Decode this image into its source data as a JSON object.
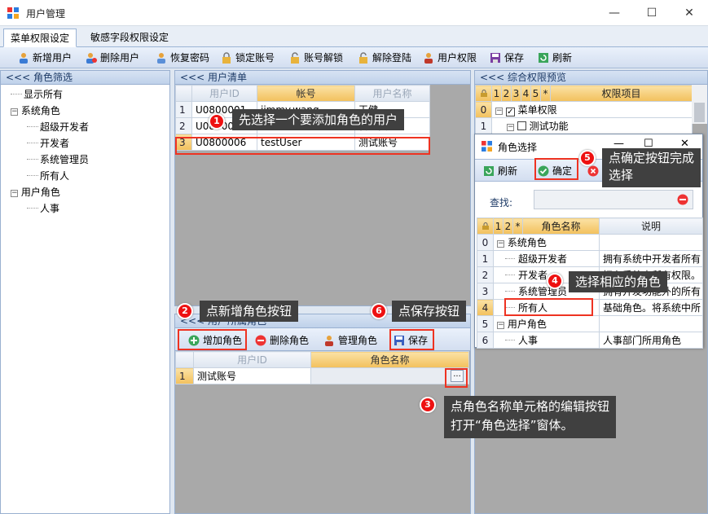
{
  "window": {
    "title": "用户管理",
    "minimize": "—",
    "maximize": "☐",
    "close": "✕"
  },
  "tabs": [
    "菜单权限设定",
    "敏感字段权限设定"
  ],
  "toolbar": [
    "新增用户",
    "删除用户",
    "恢复密码",
    "锁定账号",
    "账号解锁",
    "解除登陆",
    "用户权限",
    "保存",
    "刷新"
  ],
  "role_filter": {
    "header": "<<< 角色筛选",
    "tree": [
      {
        "label": "显示所有",
        "level": 0,
        "expander": ""
      },
      {
        "label": "系统角色",
        "level": 0,
        "expander": "−"
      },
      {
        "label": "超级开发者",
        "level": 1,
        "expander": ""
      },
      {
        "label": "开发者",
        "level": 1,
        "expander": ""
      },
      {
        "label": "系统管理员",
        "level": 1,
        "expander": ""
      },
      {
        "label": "所有人",
        "level": 1,
        "expander": ""
      },
      {
        "label": "用户角色",
        "level": 0,
        "expander": "−"
      },
      {
        "label": "人事",
        "level": 1,
        "expander": ""
      }
    ]
  },
  "user_list": {
    "header": "<<< 用户清单",
    "columns": [
      "用户ID",
      "帐号",
      "用户名称"
    ],
    "rows": [
      {
        "n": "1",
        "id": "U0800001",
        "account": "jimmy.wang",
        "name": "王健"
      },
      {
        "n": "2",
        "id": "U0800005",
        "account": "Admin",
        "name": "管理员"
      },
      {
        "n": "3",
        "id": "U0800006",
        "account": "testUser",
        "name": "测试账号"
      }
    ]
  },
  "user_roles": {
    "header": "<<< 用户所属角色",
    "buttons": [
      "增加角色",
      "删除角色",
      "管理角色",
      "保存"
    ],
    "columns": [
      "用户ID",
      "角色名称"
    ],
    "rows": [
      {
        "n": "1",
        "id": "测试账号",
        "role": ""
      }
    ],
    "edit_button": "..."
  },
  "permissions": {
    "header": "<<< 综合权限预览",
    "level_headers": [
      "1",
      "2",
      "3",
      "4",
      "5",
      "*"
    ],
    "column": "权限项目",
    "rows": [
      {
        "n": "0",
        "label": "菜单权限"
      },
      {
        "n": "1",
        "label": "测试功能"
      }
    ]
  },
  "role_dialog": {
    "title": "角色选择",
    "buttons": [
      "刷新",
      "确定",
      "取消"
    ],
    "search_label": "查找:",
    "level_headers": [
      "1",
      "2",
      "*"
    ],
    "columns": [
      "角色名称",
      "说明"
    ],
    "rows": [
      {
        "n": "0",
        "name": "系统角色",
        "desc": "",
        "group": true
      },
      {
        "n": "1",
        "name": "超级开发者",
        "desc": "拥有系统中开发者所有"
      },
      {
        "n": "2",
        "name": "开发者",
        "desc": "拥有系统中所有权限。"
      },
      {
        "n": "3",
        "name": "系统管理员",
        "desc": "拥有开发功能外的所有"
      },
      {
        "n": "4",
        "name": "所有人",
        "desc": "基础角色。将系统中所"
      },
      {
        "n": "5",
        "name": "用户角色",
        "desc": "",
        "group": true
      },
      {
        "n": "6",
        "name": "人事",
        "desc": "人事部门所用角色"
      }
    ]
  },
  "annotations": [
    {
      "n": "1",
      "text": "先选择一个要添加角色的用户"
    },
    {
      "n": "2",
      "text": "点新增角色按钮"
    },
    {
      "n": "3",
      "text": "点角色名称单元格的编辑按钮",
      "text2": "打开“角色选择”窗体。"
    },
    {
      "n": "4",
      "text": "选择相应的角色"
    },
    {
      "n": "5",
      "text": "点确定按钮完成",
      "text2": "选择"
    },
    {
      "n": "6",
      "text": "点保存按钮"
    }
  ],
  "colors": {
    "accent": "#f2c05c",
    "annotation": "#e32222",
    "callout_bg": "#404040"
  }
}
